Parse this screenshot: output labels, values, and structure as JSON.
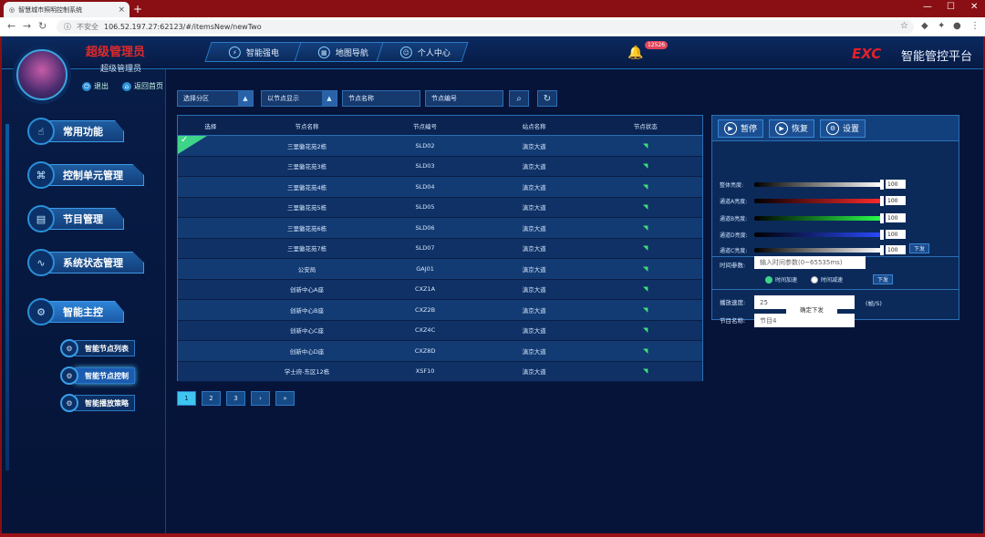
{
  "browser": {
    "tab_title": "智慧城市照明控制系统",
    "address_prefix": "不安全",
    "url": "106.52.197.27:62123/#/itemsNew/newTwo"
  },
  "user": {
    "title": "超级管理员",
    "subtitle": "超级管理员",
    "logout": "退出",
    "home": "返回首页"
  },
  "topnav": [
    {
      "label": "智能强电",
      "icon": "lightning-icon"
    },
    {
      "label": "地图导航",
      "icon": "map-icon"
    },
    {
      "label": "个人中心",
      "icon": "user-icon"
    }
  ],
  "alarm_count": "12526",
  "brand": {
    "logo": "EXC",
    "name": "智能管控平台"
  },
  "menu": [
    {
      "label": "常用功能"
    },
    {
      "label": "控制单元管理"
    },
    {
      "label": "节目管理"
    },
    {
      "label": "系统状态管理"
    },
    {
      "label": "智能主控"
    }
  ],
  "submenu": [
    {
      "label": "智能节点列表"
    },
    {
      "label": "智能节点控制"
    },
    {
      "label": "智能播放策略"
    }
  ],
  "filters": {
    "zone": "选择分区",
    "display": "以节点显示",
    "node_name": "节点名称",
    "node_code": "节点编号"
  },
  "table": {
    "headers": [
      "选择",
      "节点名称",
      "节点编号",
      "站点名称",
      "节点状态"
    ],
    "rows": [
      [
        "三里徽花苑2栋",
        "SLD02",
        "滇京大道"
      ],
      [
        "三里徽花苑3栋",
        "SLD03",
        "滇京大道"
      ],
      [
        "三里徽花苑4栋",
        "SLD04",
        "滇京大道"
      ],
      [
        "三里徽花苑5栋",
        "SLD05",
        "滇京大道"
      ],
      [
        "三里徽花苑6栋",
        "SLD06",
        "滇京大道"
      ],
      [
        "三里徽花苑7栋",
        "SLD07",
        "滇京大道"
      ],
      [
        "公安局",
        "GAJ01",
        "滇京大道"
      ],
      [
        "创新中心A座",
        "CXZ1A",
        "滇京大道"
      ],
      [
        "创新中心B座",
        "CXZ2B",
        "滇京大道"
      ],
      [
        "创新中心C座",
        "CXZ4C",
        "滇京大道"
      ],
      [
        "创新中心D座",
        "CXZ8D",
        "滇京大道"
      ],
      [
        "学士府-东区12栋",
        "XSF10",
        "滇京大道"
      ]
    ]
  },
  "pager": [
    "1",
    "2",
    "3",
    "›",
    "»"
  ],
  "control": {
    "buttons": [
      "暂停",
      "恢复",
      "设置"
    ],
    "sliders": [
      {
        "label": "整体亮度:",
        "value": "100",
        "color": "#ffffff"
      },
      {
        "label": "通道A亮度:",
        "value": "100",
        "color": "#ff2a2a"
      },
      {
        "label": "通道B亮度:",
        "value": "100",
        "color": "#2aff4a"
      },
      {
        "label": "通道D亮度:",
        "value": "100",
        "color": "#2a4aff"
      },
      {
        "label": "通道C亮度:",
        "value": "100",
        "color": "#ffffff"
      }
    ],
    "send": "下发",
    "time_label": "时间参数:",
    "time_placeholder": "输入时间参数(0~65535ms)",
    "radio1": "时间加速",
    "radio2": "时间减速",
    "speed_label": "播放速度:",
    "speed_value": "25",
    "speed_unit": "(帧/S)",
    "program_label": "节目名称:",
    "program_value": "节目4",
    "confirm": "确定下发"
  }
}
